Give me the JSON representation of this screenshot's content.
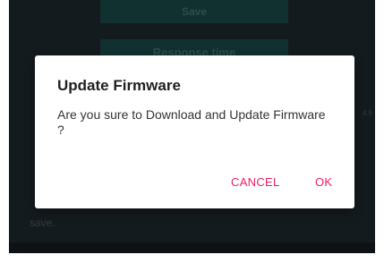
{
  "background": {
    "save_label": "Save",
    "response_time_label": "Response time",
    "side_value": "4.9",
    "trailing_text": "save."
  },
  "dialog": {
    "title": "Update Firmware",
    "message": "Are you sure to Download and Update Firmware ?",
    "cancel_label": "CANCEL",
    "ok_label": "OK"
  },
  "colors": {
    "accent": "#e91e63",
    "screen_background": "#263238",
    "dialog_background": "#ffffff"
  }
}
